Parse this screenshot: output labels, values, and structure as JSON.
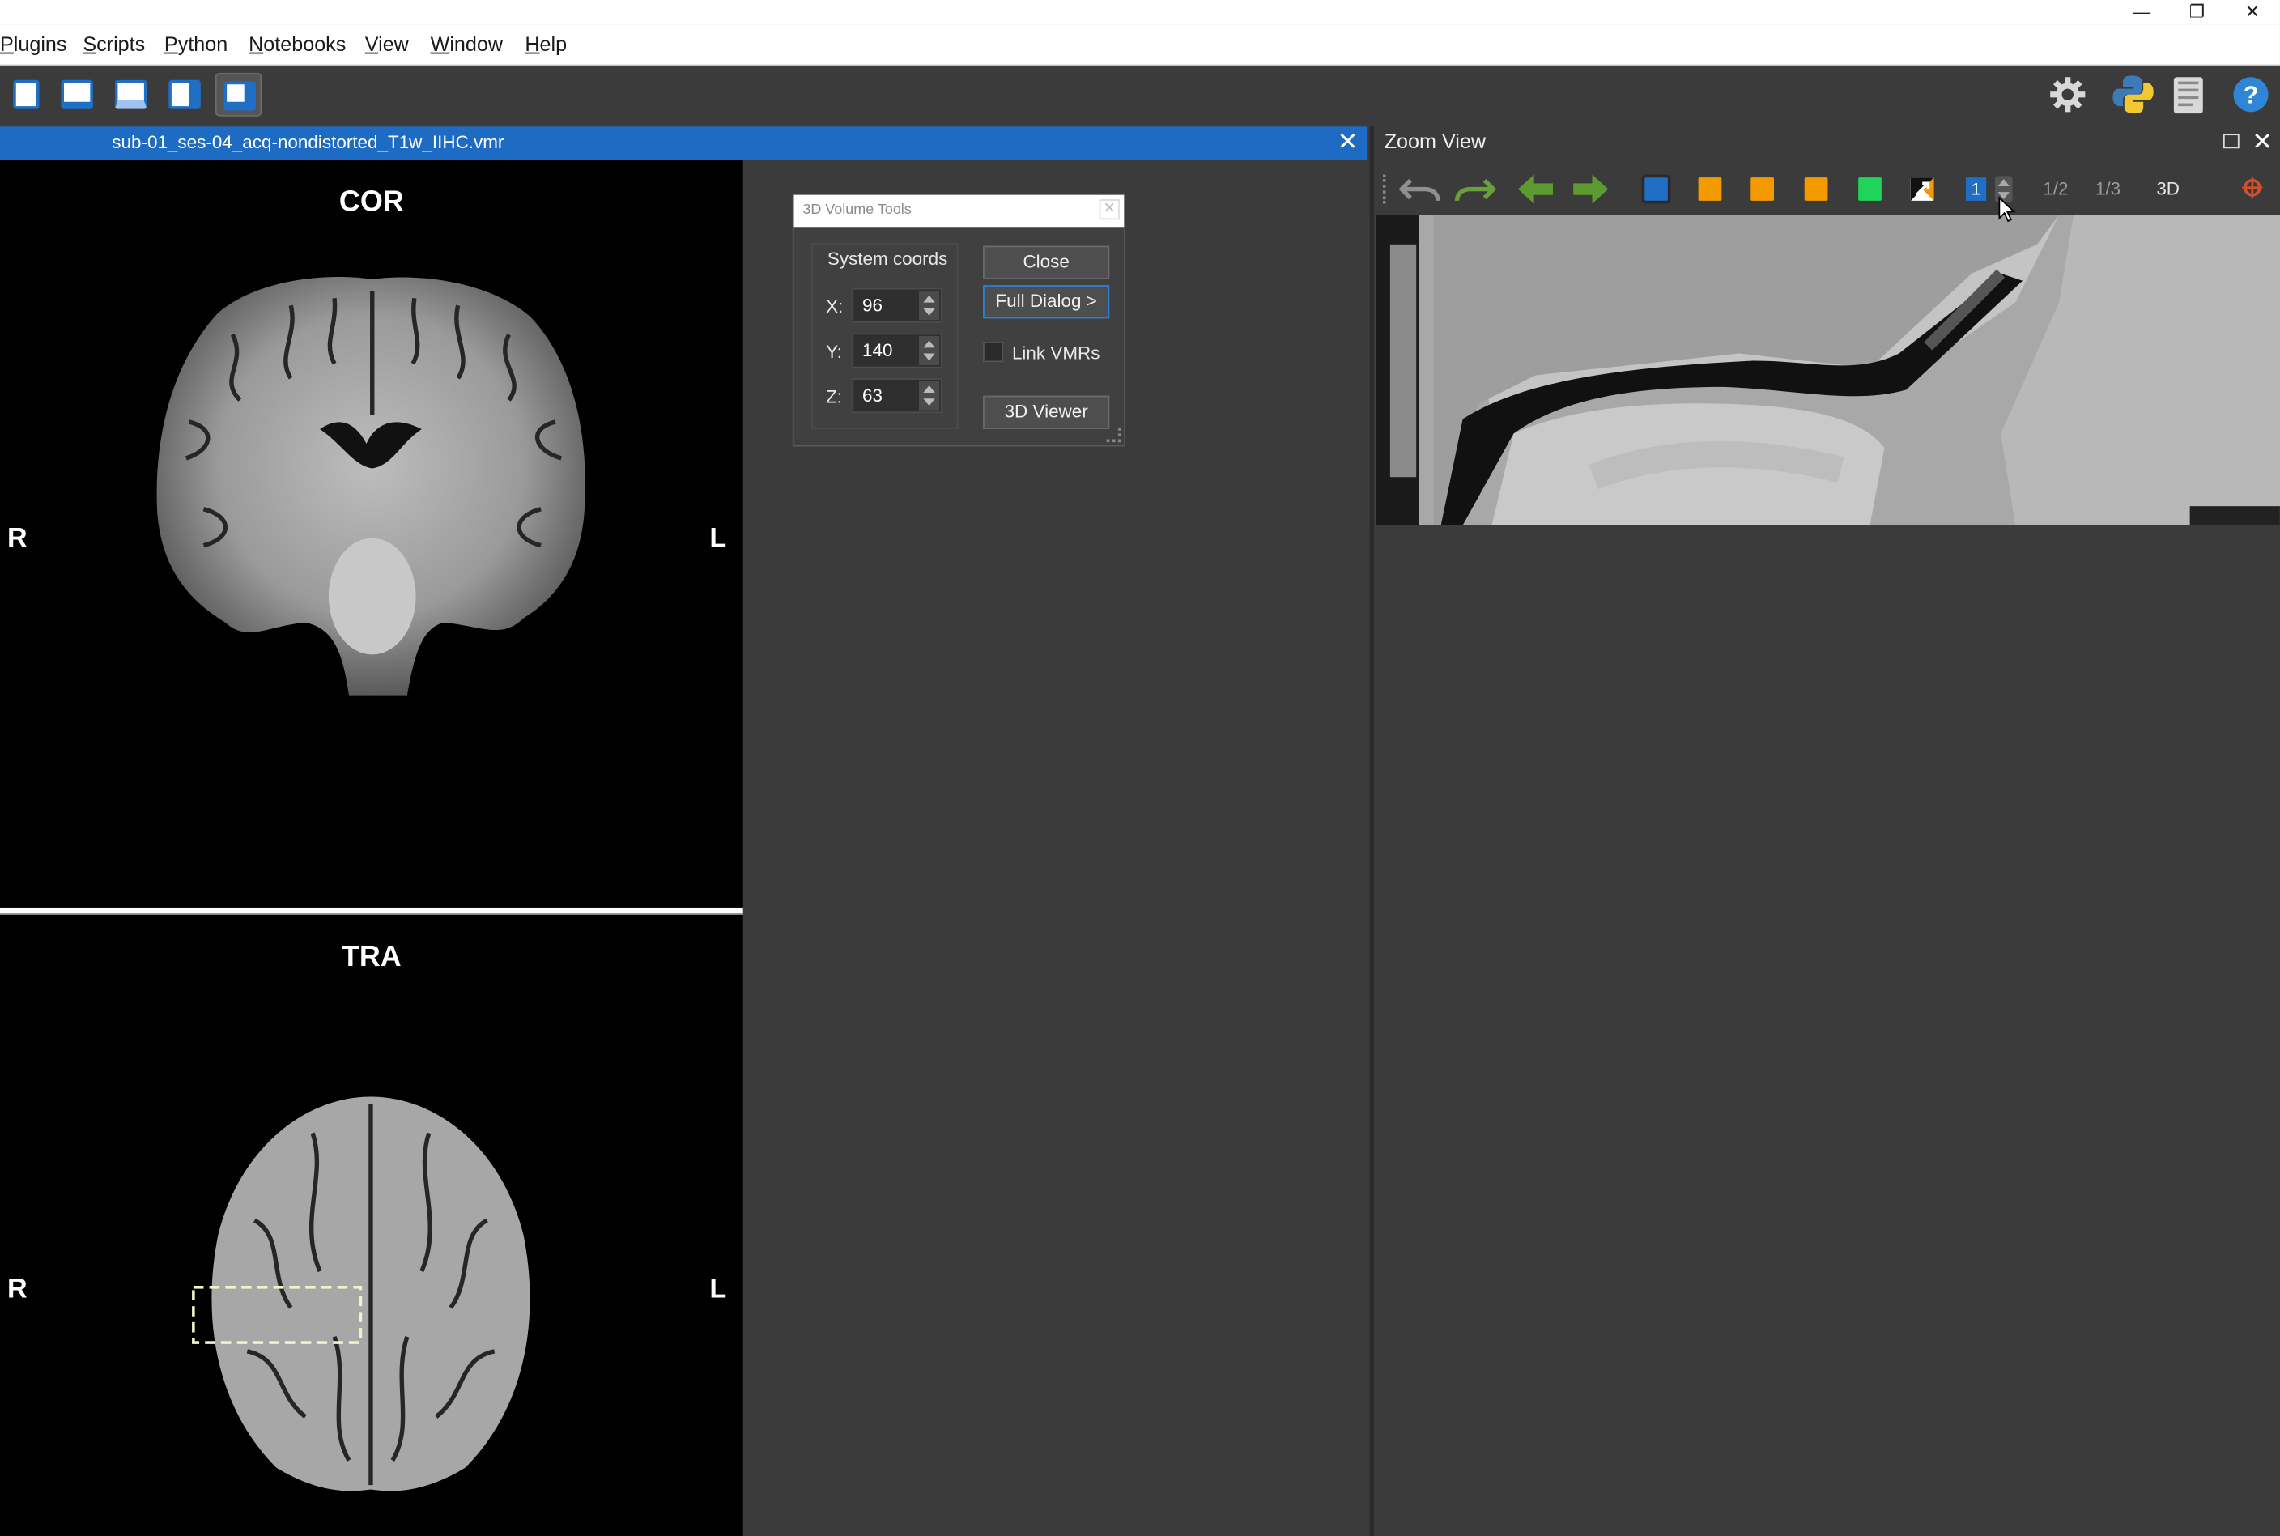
{
  "window": {
    "minimize": "—",
    "restore": "❐",
    "close": "✕"
  },
  "menu": [
    {
      "label": "Plugins",
      "u": "P",
      "rest": "lugins"
    },
    {
      "label": "Scripts",
      "u": "S",
      "rest": "cripts"
    },
    {
      "label": "Python",
      "u": "P",
      "rest": "ython"
    },
    {
      "label": "Notebooks",
      "u": "N",
      "rest": "otebooks"
    },
    {
      "label": "View",
      "u": "V",
      "rest": "iew"
    },
    {
      "label": "Window",
      "u": "W",
      "rest": "indow"
    },
    {
      "label": "Help",
      "u": "H",
      "rest": "elp"
    }
  ],
  "document": {
    "title": "sub-01_ses-04_acq-nondistorted_T1w_IIHC.vmr",
    "close": "✕"
  },
  "views": {
    "cor": {
      "title": "COR",
      "left": "R",
      "right": "L"
    },
    "tra": {
      "title": "TRA",
      "left": "R",
      "right": "L"
    }
  },
  "volume_tools": {
    "title": "3D Volume Tools",
    "close_x": "✕",
    "group_label": "System coords",
    "x_label": "X:",
    "x_value": "96",
    "y_label": "Y:",
    "y_value": "140",
    "z_label": "Z:",
    "z_value": "63",
    "close_button": "Close",
    "full_dialog_button": "Full Dialog >",
    "link_vmrs_label": "Link VMRs",
    "viewer_button": "3D Viewer"
  },
  "zoom_view": {
    "title": "Zoom View",
    "close": "✕",
    "slice_number": "1",
    "half": "1/2",
    "third": "1/3",
    "three_d": "3D"
  },
  "colors": {
    "accent_blue": "#1e6bc3",
    "orange": "#f39a00",
    "green": "#1ed45a",
    "panel": "#3b3b3b"
  },
  "icons": [
    "undo-icon",
    "redo-icon",
    "back-arrow-icon",
    "forward-arrow-icon",
    "settings-icon",
    "python-icon",
    "notes-icon",
    "help-icon"
  ]
}
